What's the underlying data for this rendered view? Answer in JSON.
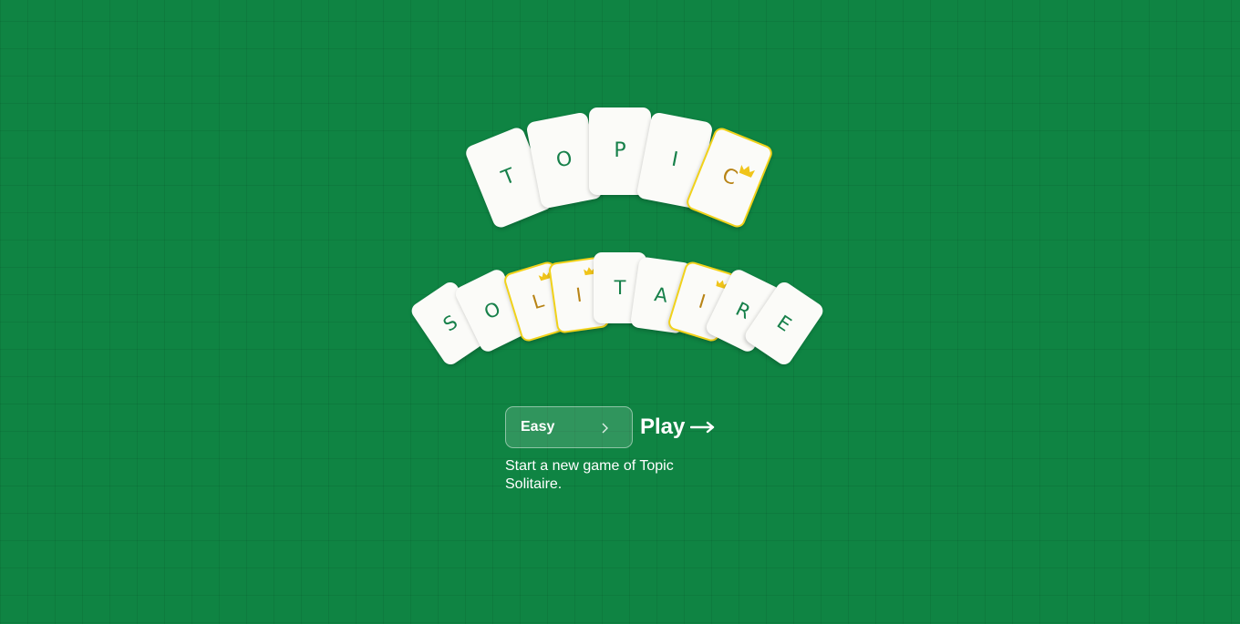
{
  "title": {
    "word1": [
      "T",
      "O",
      "P",
      "I",
      "C"
    ],
    "word2": [
      "S",
      "O",
      "L",
      "I",
      "T",
      "A",
      "I",
      "R",
      "E"
    ]
  },
  "gold_cards": {
    "word1": [
      4
    ],
    "word2": [
      2,
      3,
      6
    ]
  },
  "icons": {
    "crown": "crown-icon",
    "difficulty_chevron": "chevron-right-icon",
    "play_arrow": "arrow-right-icon"
  },
  "colors": {
    "felt": "#0f8443",
    "card_face": "#fbfbf8",
    "letter_green": "#17804a",
    "gold_border": "#f1d21a",
    "gold_letter": "#b88416"
  },
  "controls": {
    "difficulty": "Easy",
    "play_label": "Play",
    "description": "Start a new game of Topic Solitaire."
  }
}
